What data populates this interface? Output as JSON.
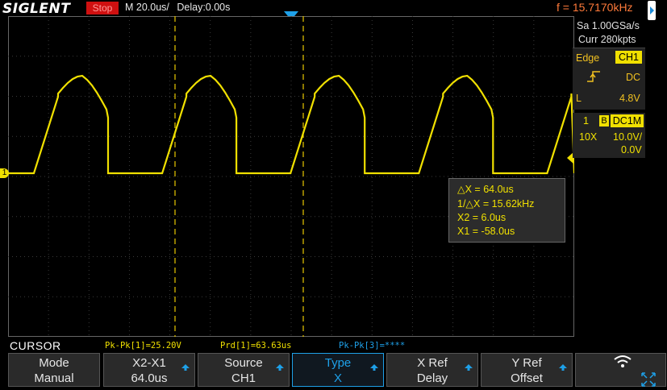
{
  "header": {
    "brand": "SIGLENT",
    "run_state": "Stop",
    "timebase": "M 20.0us/",
    "delay": "Delay:0.00s",
    "frequency": "f = 15.7170kHz"
  },
  "acquisition": {
    "sample_rate": "Sa 1.00GSa/s",
    "memory_depth": "Curr 280kpts"
  },
  "trigger": {
    "type": "Edge",
    "source": "CH1",
    "slope_icon": "rising-edge-icon",
    "coupling": "DC",
    "level_label": "L",
    "level_value": "4.8V"
  },
  "channel": {
    "number": "1",
    "bw_limit": "B",
    "coupling": "DC1M",
    "probe": "10X",
    "volts_per_div": "10.0V/",
    "offset": "0.0V",
    "marker": "1"
  },
  "cursor_readout": {
    "delta_x": "△X = 64.0us",
    "inv_delta_x": "1/△X = 15.62kHz",
    "x2": "X2 = 6.0us",
    "x1": "X1 = -58.0us"
  },
  "measurements": {
    "pkpk1": "Pk-Pk[1]=25.20V",
    "prd1": "Prd[1]=63.63us",
    "pkpk3": "Pk-Pk[3]=****"
  },
  "menu": {
    "title": "CURSOR",
    "softkeys": [
      {
        "label": "Mode",
        "value": "Manual"
      },
      {
        "label": "X2-X1",
        "value": "64.0us"
      },
      {
        "label": "Source",
        "value": "CH1"
      },
      {
        "label": "Type",
        "value": "X"
      },
      {
        "label": "X Ref",
        "value": "Delay"
      },
      {
        "label": "Y Ref",
        "value": "Offset"
      }
    ]
  },
  "colors": {
    "trace": "#f0e000",
    "accent": "#1ea0e8",
    "frequency": "#ff7a3a",
    "stop": "#d01010"
  }
}
